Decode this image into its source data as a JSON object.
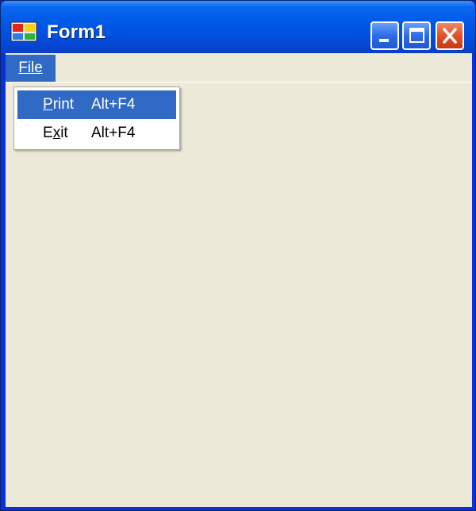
{
  "window": {
    "title": "Form1",
    "controls": {
      "minimize_icon": "minimize-icon",
      "maximize_icon": "maximize-icon",
      "close_icon": "close-icon"
    }
  },
  "menubar": {
    "file": {
      "label": "File",
      "mnemonic": "F"
    }
  },
  "dropdown": {
    "items": [
      {
        "label": "Print",
        "mnemonic": "P",
        "shortcut": "Alt+F4",
        "selected": true
      },
      {
        "label": "Exit",
        "mnemonic": "x",
        "shortcut": "Alt+F4",
        "selected": false
      }
    ]
  },
  "colors": {
    "titlebar": "#0058e6",
    "client_bg": "#ece9d8",
    "highlight": "#316ac5",
    "close_button": "#e0512a"
  }
}
